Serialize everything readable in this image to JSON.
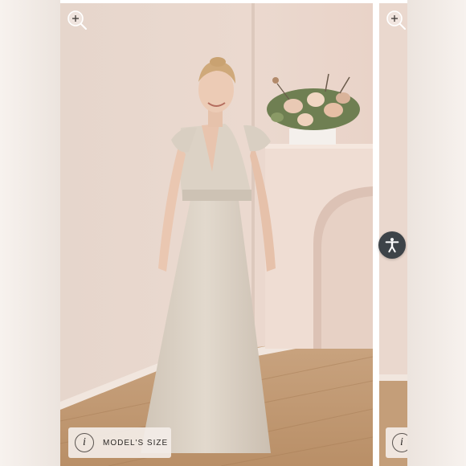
{
  "gallery": {
    "main_slide": {
      "info_chip": {
        "icon_glyph": "i",
        "label": "MODEL'S SIZE"
      }
    },
    "next_slide": {
      "info_chip": {
        "icon_glyph": "i"
      }
    }
  },
  "icons": {
    "zoom": "zoom-in-icon",
    "info": "info-icon",
    "accessibility": "accessibility-icon"
  },
  "colors": {
    "wall": "#e8d6cb",
    "floor": "#c9a27b",
    "dress": "#ddd3c6",
    "accessibility_button": "#3d4348"
  }
}
